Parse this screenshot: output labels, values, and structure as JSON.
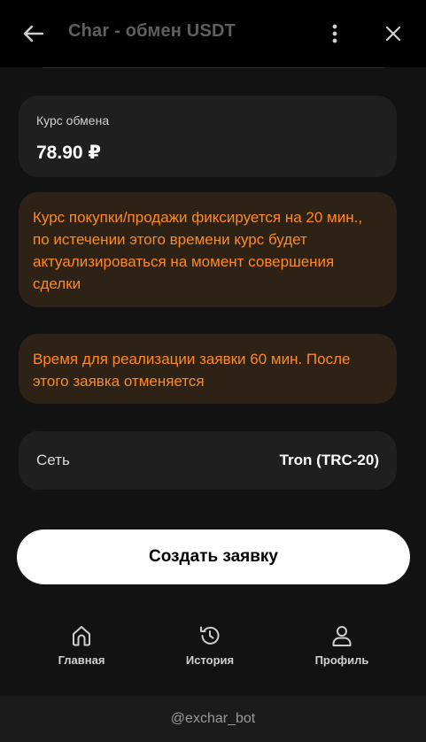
{
  "header": {
    "title": "Char - обмен USDT",
    "back_icon": "arrow-left-icon",
    "menu_icon": "dots-vertical-icon",
    "close_icon": "close-icon"
  },
  "rate": {
    "label": "Курс обмена",
    "value": "78.90 ₽"
  },
  "notices": [
    {
      "text": "Курс покупки/продажи фиксируется на 20 мин., по истечении этого времени курс будет актуализироваться на момент совершения сделки"
    },
    {
      "text": "Время для реализации заявки 60 мин. После этого заявка отменяется"
    }
  ],
  "network": {
    "label": "Сеть",
    "value": "Tron (TRC-20)"
  },
  "create_button": {
    "label": "Создать заявку"
  },
  "nav": {
    "items": [
      {
        "label": "Главная",
        "icon": "home-icon"
      },
      {
        "label": "История",
        "icon": "history-icon"
      },
      {
        "label": "Профиль",
        "icon": "user-icon"
      }
    ]
  },
  "footer": {
    "text": "@exchar_bot"
  },
  "colors": {
    "background": "#000000",
    "content_bg": "#121212",
    "card_bg": "#1f1f1f",
    "notice_bg": "#2e2216",
    "notice_text": "#ff8a1e",
    "button_bg": "#ffffff",
    "title_text": "#5f5f5f"
  }
}
